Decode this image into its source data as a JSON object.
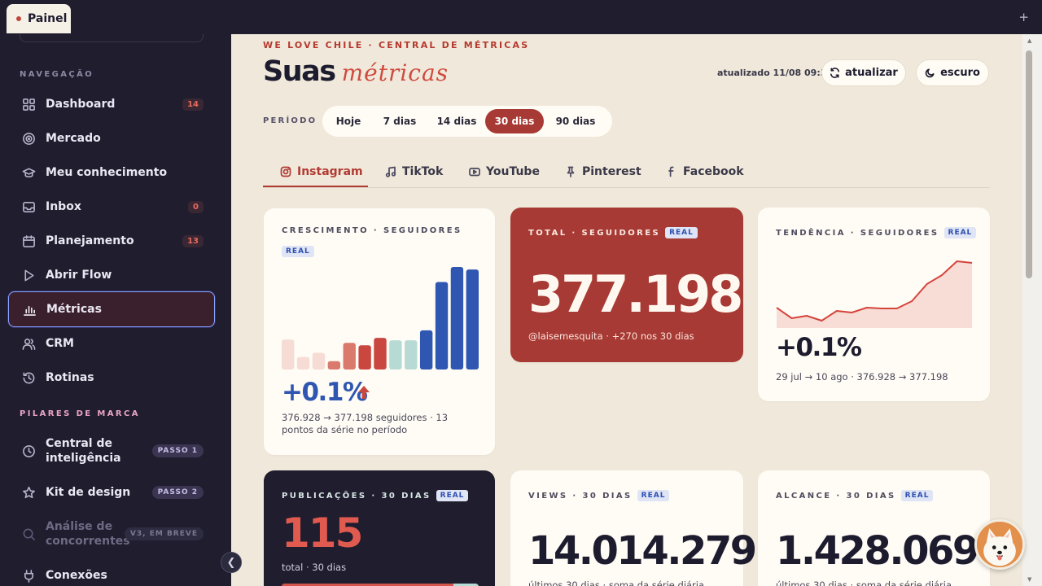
{
  "browser": {
    "tab_title": "Painel",
    "new_tab_icon": "+"
  },
  "sidebar": {
    "section_nav": "NAVEGAÇÃO",
    "section_brand": "PILARES DE MARCA",
    "items": [
      {
        "label": "Dashboard",
        "badge": "14",
        "icon": "grid-icon"
      },
      {
        "label": "Mercado",
        "badge": "",
        "icon": "target-icon"
      },
      {
        "label": "Meu conhecimento",
        "badge": "",
        "icon": "graduation-cap-icon"
      },
      {
        "label": "Inbox",
        "badge": "0",
        "icon": "inbox-icon"
      },
      {
        "label": "Planejamento",
        "badge": "13",
        "icon": "calendar-icon"
      },
      {
        "label": "Abrir Flow",
        "badge": "",
        "icon": "play-icon"
      },
      {
        "label": "Métricas",
        "badge": "",
        "icon": "bar-chart-icon"
      },
      {
        "label": "CRM",
        "badge": "",
        "icon": "users-icon"
      },
      {
        "label": "Rotinas",
        "badge": "",
        "icon": "history-icon"
      }
    ],
    "brand_items": [
      {
        "label": "Central de inteligência",
        "pill": "PASSO 1",
        "icon": "clock-icon"
      },
      {
        "label": "Kit de design",
        "pill": "PASSO 2",
        "icon": "star-icon"
      },
      {
        "label": "Análise de concorrentes",
        "pill": "V3, EM BREVE",
        "icon": "search-icon"
      },
      {
        "label": "Conexões",
        "pill": "",
        "icon": "plug-icon"
      }
    ]
  },
  "header": {
    "kicker": "WE LOVE CHILE · CENTRAL DE MÉTRICAS",
    "title_main": "Suas",
    "title_script": "métricas",
    "updated": "atualizado 11/08 09:30",
    "refresh_label": "atualizar",
    "theme_label": "escuro"
  },
  "period": {
    "label": "PERÍODO",
    "options": [
      "Hoje",
      "7 dias",
      "14 dias",
      "30 dias",
      "90 dias"
    ],
    "selected": "30 dias"
  },
  "social_tabs": [
    "Instagram",
    "TikTok",
    "YouTube",
    "Pinterest",
    "Facebook"
  ],
  "cards": {
    "growth": {
      "label": "CRESCIMENTO · SEGUIDORES",
      "tag": "REAL",
      "pct": "+0.1%",
      "desc": "376.928 → 377.198 seguidores · 13 pontos da série no período"
    },
    "total": {
      "label": "TOTAL · SEGUIDORES",
      "tag": "REAL",
      "value": "377.198",
      "sub": "@laisemesquita · +270 nos 30 dias"
    },
    "trend": {
      "label": "TENDÊNCIA · SEGUIDORES",
      "tag": "REAL",
      "pct": "+0.1%",
      "sub": "29 jul → 10 ago · 376.928 → 377.198"
    },
    "posts": {
      "label": "PUBLICAÇÕES · 30 DIAS",
      "tag": "REAL",
      "value": "115",
      "sub": "total · 30 dias"
    },
    "views": {
      "label": "VIEWS · 30 DIAS",
      "tag": "REAL",
      "value": "14.014.279",
      "sub": "últimos 30 dias · soma da série diária"
    },
    "reach": {
      "label": "ALCANCE · 30 DIAS",
      "tag": "REAL",
      "value": "1.428.069",
      "sub": "últimos 30 dias · soma da série diária"
    }
  },
  "chart_data": [
    {
      "type": "bar",
      "title": "CRESCIMENTO · SEGUIDORES",
      "categories": [
        "1",
        "2",
        "3",
        "4",
        "5",
        "6",
        "7",
        "8",
        "9",
        "10",
        "11",
        "12",
        "13"
      ],
      "values": [
        36,
        15,
        20,
        10,
        32,
        29,
        38,
        35,
        35,
        47,
        105,
        123,
        120
      ],
      "colors": [
        "#f6dcd5",
        "#f6dcd5",
        "#f6dcd5",
        "#d97a6c",
        "#d97a6c",
        "#c9473f",
        "#c9473f",
        "#b7dad4",
        "#b7dad4",
        "#2f56b0",
        "#2f56b0",
        "#2f56b0",
        "#2f56b0"
      ],
      "note": "relative heights; axes not labeled"
    },
    {
      "type": "area",
      "title": "TENDÊNCIA · SEGUIDORES",
      "x": [
        "1",
        "2",
        "3",
        "4",
        "5",
        "6",
        "7",
        "8",
        "9",
        "10",
        "11",
        "12",
        "13",
        "14"
      ],
      "values": [
        25,
        12,
        15,
        9,
        21,
        19,
        25,
        24,
        24,
        33,
        54,
        65,
        82,
        80
      ],
      "note": "relative series shape; axes not labeled"
    }
  ]
}
